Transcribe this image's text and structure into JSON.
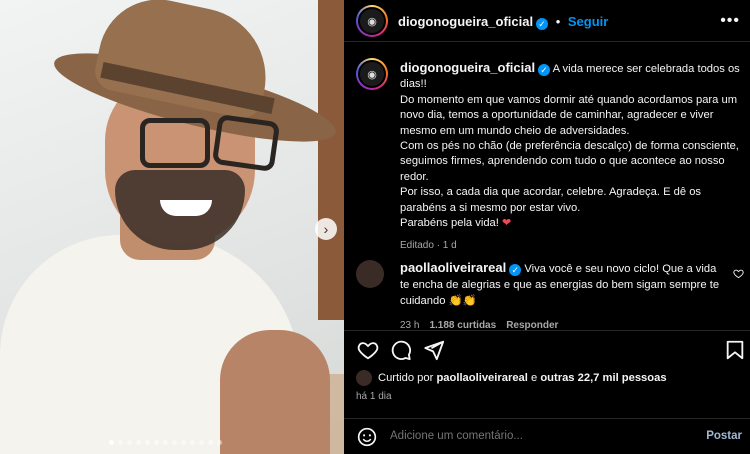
{
  "post": {
    "author": "diogonogueira_oficial",
    "follow_label": "Seguir",
    "more_label": "•••",
    "next_label": "›",
    "carousel_count": 13,
    "carousel_active": 1
  },
  "caption": {
    "author": "diogonogueira_oficial",
    "first": "A vida merece ser celebrada todos os dias!!",
    "lines": [
      "Do momento em que vamos dormir até quando acordamos para um novo dia, temos a oportunidade de caminhar, agradecer e viver mesmo em um mundo cheio de adversidades.",
      "Com os pés no chão (de preferência descalço) de forma consciente, seguimos firmes, aprendendo com tudo o que acontece ao nosso redor.",
      "Por isso, a cada dia que acordar, celebre. Agradeça. E dê os parabéns a si mesmo por estar vivo."
    ],
    "last": "Parabéns pela vida!",
    "heart": "❤",
    "meta": "Editado · 1 d"
  },
  "comment": {
    "author": "paollaoliveirareal",
    "text": "Viva você e seu novo ciclo! Que a vida te encha de alegrias e que as energias do bem sigam sempre te cuidando",
    "emoji": "👏👏",
    "time": "23 h",
    "likes": "1.188 curtidas",
    "reply": "Responder"
  },
  "likes": {
    "prefix": "Curtido por",
    "user": "paollaoliveirareal",
    "mid": "e",
    "others": "outras 22,7 mil pessoas"
  },
  "date": "há 1 dia",
  "add_comment": {
    "placeholder": "Adicione um comentário...",
    "post_label": "Postar"
  },
  "colors": {
    "link": "#0095f6",
    "heart": "#ed4956"
  }
}
